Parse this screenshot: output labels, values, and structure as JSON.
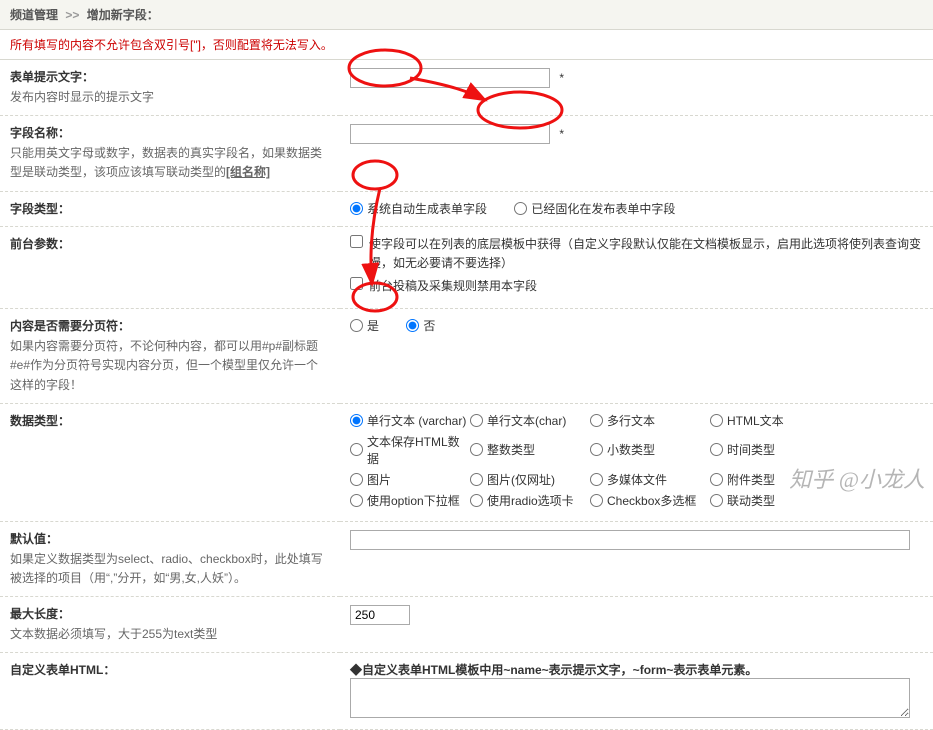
{
  "breadcrumb": {
    "a": "频道管理",
    "b": "增加新字段："
  },
  "warn": "所有填写的内容不允许包含双引号[\"]，否则配置将无法写入。",
  "rows": {
    "prompt": {
      "title": "表单提示文字：",
      "desc": "发布内容时显示的提示文字",
      "value": "",
      "req": "*"
    },
    "name": {
      "title": "字段名称：",
      "desc_a": "只能用英文字母或数字，数据表的真实字段名，如果数据类型是联动类型，该项应该填写联动类型的",
      "desc_b": "[组名称]",
      "value": "",
      "req": "*"
    },
    "fieldtype": {
      "title": "字段类型：",
      "opt1": "系统自动生成表单字段",
      "opt2": "已经固化在发布表单中字段"
    },
    "front": {
      "title": "前台参数：",
      "cb1": "使字段可以在列表的底层模板中获得（自定义字段默认仅能在文档模板显示，启用此选项将使列表查询变慢，如无必要请不要选择）",
      "cb2": "前台投稿及采集规则禁用本字段"
    },
    "pagebreak": {
      "title": "内容是否需要分页符：",
      "desc": "如果内容需要分页符，不论何种内容，都可以用#p#副标题#e#作为分页符号实现内容分页，但一个模型里仅允许一个这样的字段！",
      "yes": "是",
      "no": "否"
    },
    "datatype": {
      "title": "数据类型：",
      "opts": [
        "单行文本 (varchar)",
        "单行文本(char)",
        "多行文本",
        "HTML文本",
        "文本保存HTML数据",
        "整数类型",
        "小数类型",
        "时间类型",
        "图片",
        "图片(仅网址)",
        "多媒体文件",
        "附件类型",
        "使用option下拉框",
        "使用radio选项卡",
        "Checkbox多选框",
        "联动类型"
      ]
    },
    "default": {
      "title": "默认值：",
      "desc": "如果定义数据类型为select、radio、checkbox时，此处填写被选择的项目（用“,”分开，如“男,女,人妖”）。",
      "value": ""
    },
    "maxlen": {
      "title": "最大长度：",
      "desc": "文本数据必须填写，大于255为text类型",
      "value": "250"
    },
    "customhtml": {
      "title": "自定义表单HTML：",
      "intro": "◆自定义表单HTML模板中用~name~表示提示文字，~form~表示表单元素。",
      "value": ""
    }
  },
  "watermark": "知乎 @小龙人"
}
